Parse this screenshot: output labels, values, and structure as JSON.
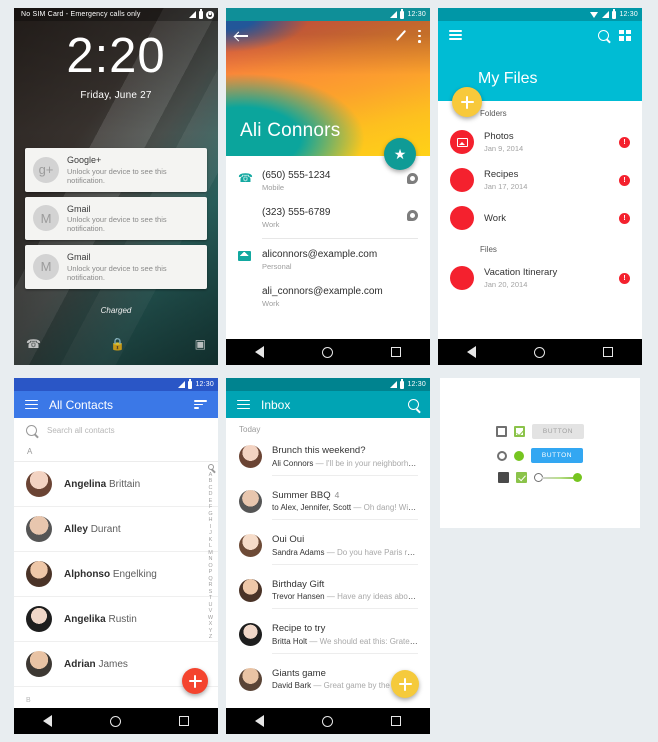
{
  "lock_screen": {
    "status": {
      "carrier": "No SIM Card - Emergency calls only",
      "signal_icon": "signal-icon",
      "battery_icon": "battery-icon",
      "account_icon": "account-icon"
    },
    "time": "2:20",
    "date": "Friday, June 27",
    "notifications": [
      {
        "app": "Google+",
        "text": "Unlock your device to see this notification.",
        "icon": "google-plus-icon",
        "glyph": "g+"
      },
      {
        "app": "Gmail",
        "text": "Unlock your device to see this notification.",
        "icon": "gmail-icon",
        "glyph": "M"
      },
      {
        "app": "Gmail",
        "text": "Unlock your device to see this notification.",
        "icon": "gmail-icon",
        "glyph": "M"
      }
    ],
    "charge_status": "Charged",
    "shortcuts": {
      "phone": "✆",
      "lock": "A",
      "camera": "▣"
    }
  },
  "contact_screen": {
    "status": {
      "time": "12:30"
    },
    "name": "Ali Connors",
    "actions": {
      "back": "back-arrow-icon",
      "edit": "edit-pencil-icon",
      "overflow": "overflow-menu-icon",
      "favorite": "★"
    },
    "rows": [
      {
        "value": "(650) 555-1234",
        "label": "Mobile",
        "lead_icon": "phone-icon",
        "trail_icon": "message-icon"
      },
      {
        "value": "(323) 555-6789",
        "label": "Work",
        "lead_icon": "",
        "trail_icon": "message-icon"
      },
      {
        "value": "aliconnors@example.com",
        "label": "Personal",
        "lead_icon": "email-icon",
        "trail_icon": ""
      },
      {
        "value": "ali_connors@example.com",
        "label": "Work",
        "lead_icon": "",
        "trail_icon": ""
      }
    ]
  },
  "files_screen": {
    "status": {
      "time": "12:30"
    },
    "title": "My Files",
    "actions": {
      "menu": "hamburger-icon",
      "search": "search-icon",
      "grid": "grid-view-icon",
      "add": "add-icon"
    },
    "sections": [
      {
        "label": "Folders",
        "items": [
          {
            "name": "Photos",
            "date": "Jan 9, 2014",
            "badge": "!"
          },
          {
            "name": "Recipes",
            "date": "Jan 17, 2014",
            "badge": "!"
          },
          {
            "name": "Work",
            "date": "",
            "badge": "!"
          }
        ]
      },
      {
        "label": "Files",
        "items": [
          {
            "name": "Vacation Itinerary",
            "date": "Jan 20, 2014",
            "badge": "!"
          }
        ]
      }
    ],
    "accent": "#00bcd4",
    "fab_color": "#f8c93b",
    "icon_color": "#f4212e"
  },
  "contacts_screen": {
    "status": {
      "time": "12:30"
    },
    "title": "All Contacts",
    "search_placeholder": "Search all contacts",
    "section": "A",
    "contacts": [
      {
        "first": "Angelina",
        "last": "Brittain"
      },
      {
        "first": "Alley",
        "last": "Durant"
      },
      {
        "first": "Alphonso",
        "last": "Engelking"
      },
      {
        "first": "Angelika",
        "last": "Rustin"
      },
      {
        "first": "Adrian",
        "last": "James"
      }
    ],
    "scrubber": [
      "A",
      "B",
      "C",
      "D",
      "E",
      "F",
      "G",
      "H",
      "I",
      "J",
      "K",
      "L",
      "M",
      "N",
      "O",
      "P",
      "Q",
      "R",
      "S",
      "T",
      "U",
      "V",
      "W",
      "X",
      "Y",
      "Z"
    ],
    "footer": "B",
    "accent": "#3b78e7",
    "fab_color": "#f4442e"
  },
  "inbox_screen": {
    "status": {
      "time": "12:30"
    },
    "title": "Inbox",
    "section": "Today",
    "emails": [
      {
        "subject": "Brunch this weekend?",
        "count": "",
        "sender": "Ali Connors",
        "preview": "I'll be in your neighborhood ..."
      },
      {
        "subject": "Summer BBQ",
        "count": "4",
        "sender": "to Alex, Jennifer, Scott",
        "preview": "Oh dang! Wish I ..."
      },
      {
        "subject": "Oui Oui",
        "count": "",
        "sender": "Sandra Adams",
        "preview": "Do you have Paris reco ..."
      },
      {
        "subject": "Birthday Gift",
        "count": "",
        "sender": "Trevor Hansen",
        "preview": "Have any ideas about ..."
      },
      {
        "subject": "Recipe to try",
        "count": "",
        "sender": "Britta Holt",
        "preview": "We should eat this: Grated ..."
      },
      {
        "subject": "Giants game",
        "count": "",
        "sender": "David Bark",
        "preview": "Great game by the team of ..."
      }
    ],
    "accent": "#00a4b4",
    "fab_color": "#f5ca3c"
  },
  "controls_screen": {
    "rows": [
      {
        "checkbox": "unchecked-checkbox",
        "checkbox2": "checked-checkbox-outline",
        "button_label": "BUTTON",
        "button_style": "flat"
      },
      {
        "radio": "unselected-radio",
        "radio2": "selected-radio",
        "button_label": "BUTTON",
        "button_style": "raised"
      },
      {
        "checkbox": "dark-checkbox",
        "checkbox2": "filled-checkbox",
        "slider": "slider-control"
      }
    ],
    "colors": {
      "green": "#8bc34a",
      "blue": "#33a7f2",
      "grey": "#e3e3e3"
    }
  }
}
